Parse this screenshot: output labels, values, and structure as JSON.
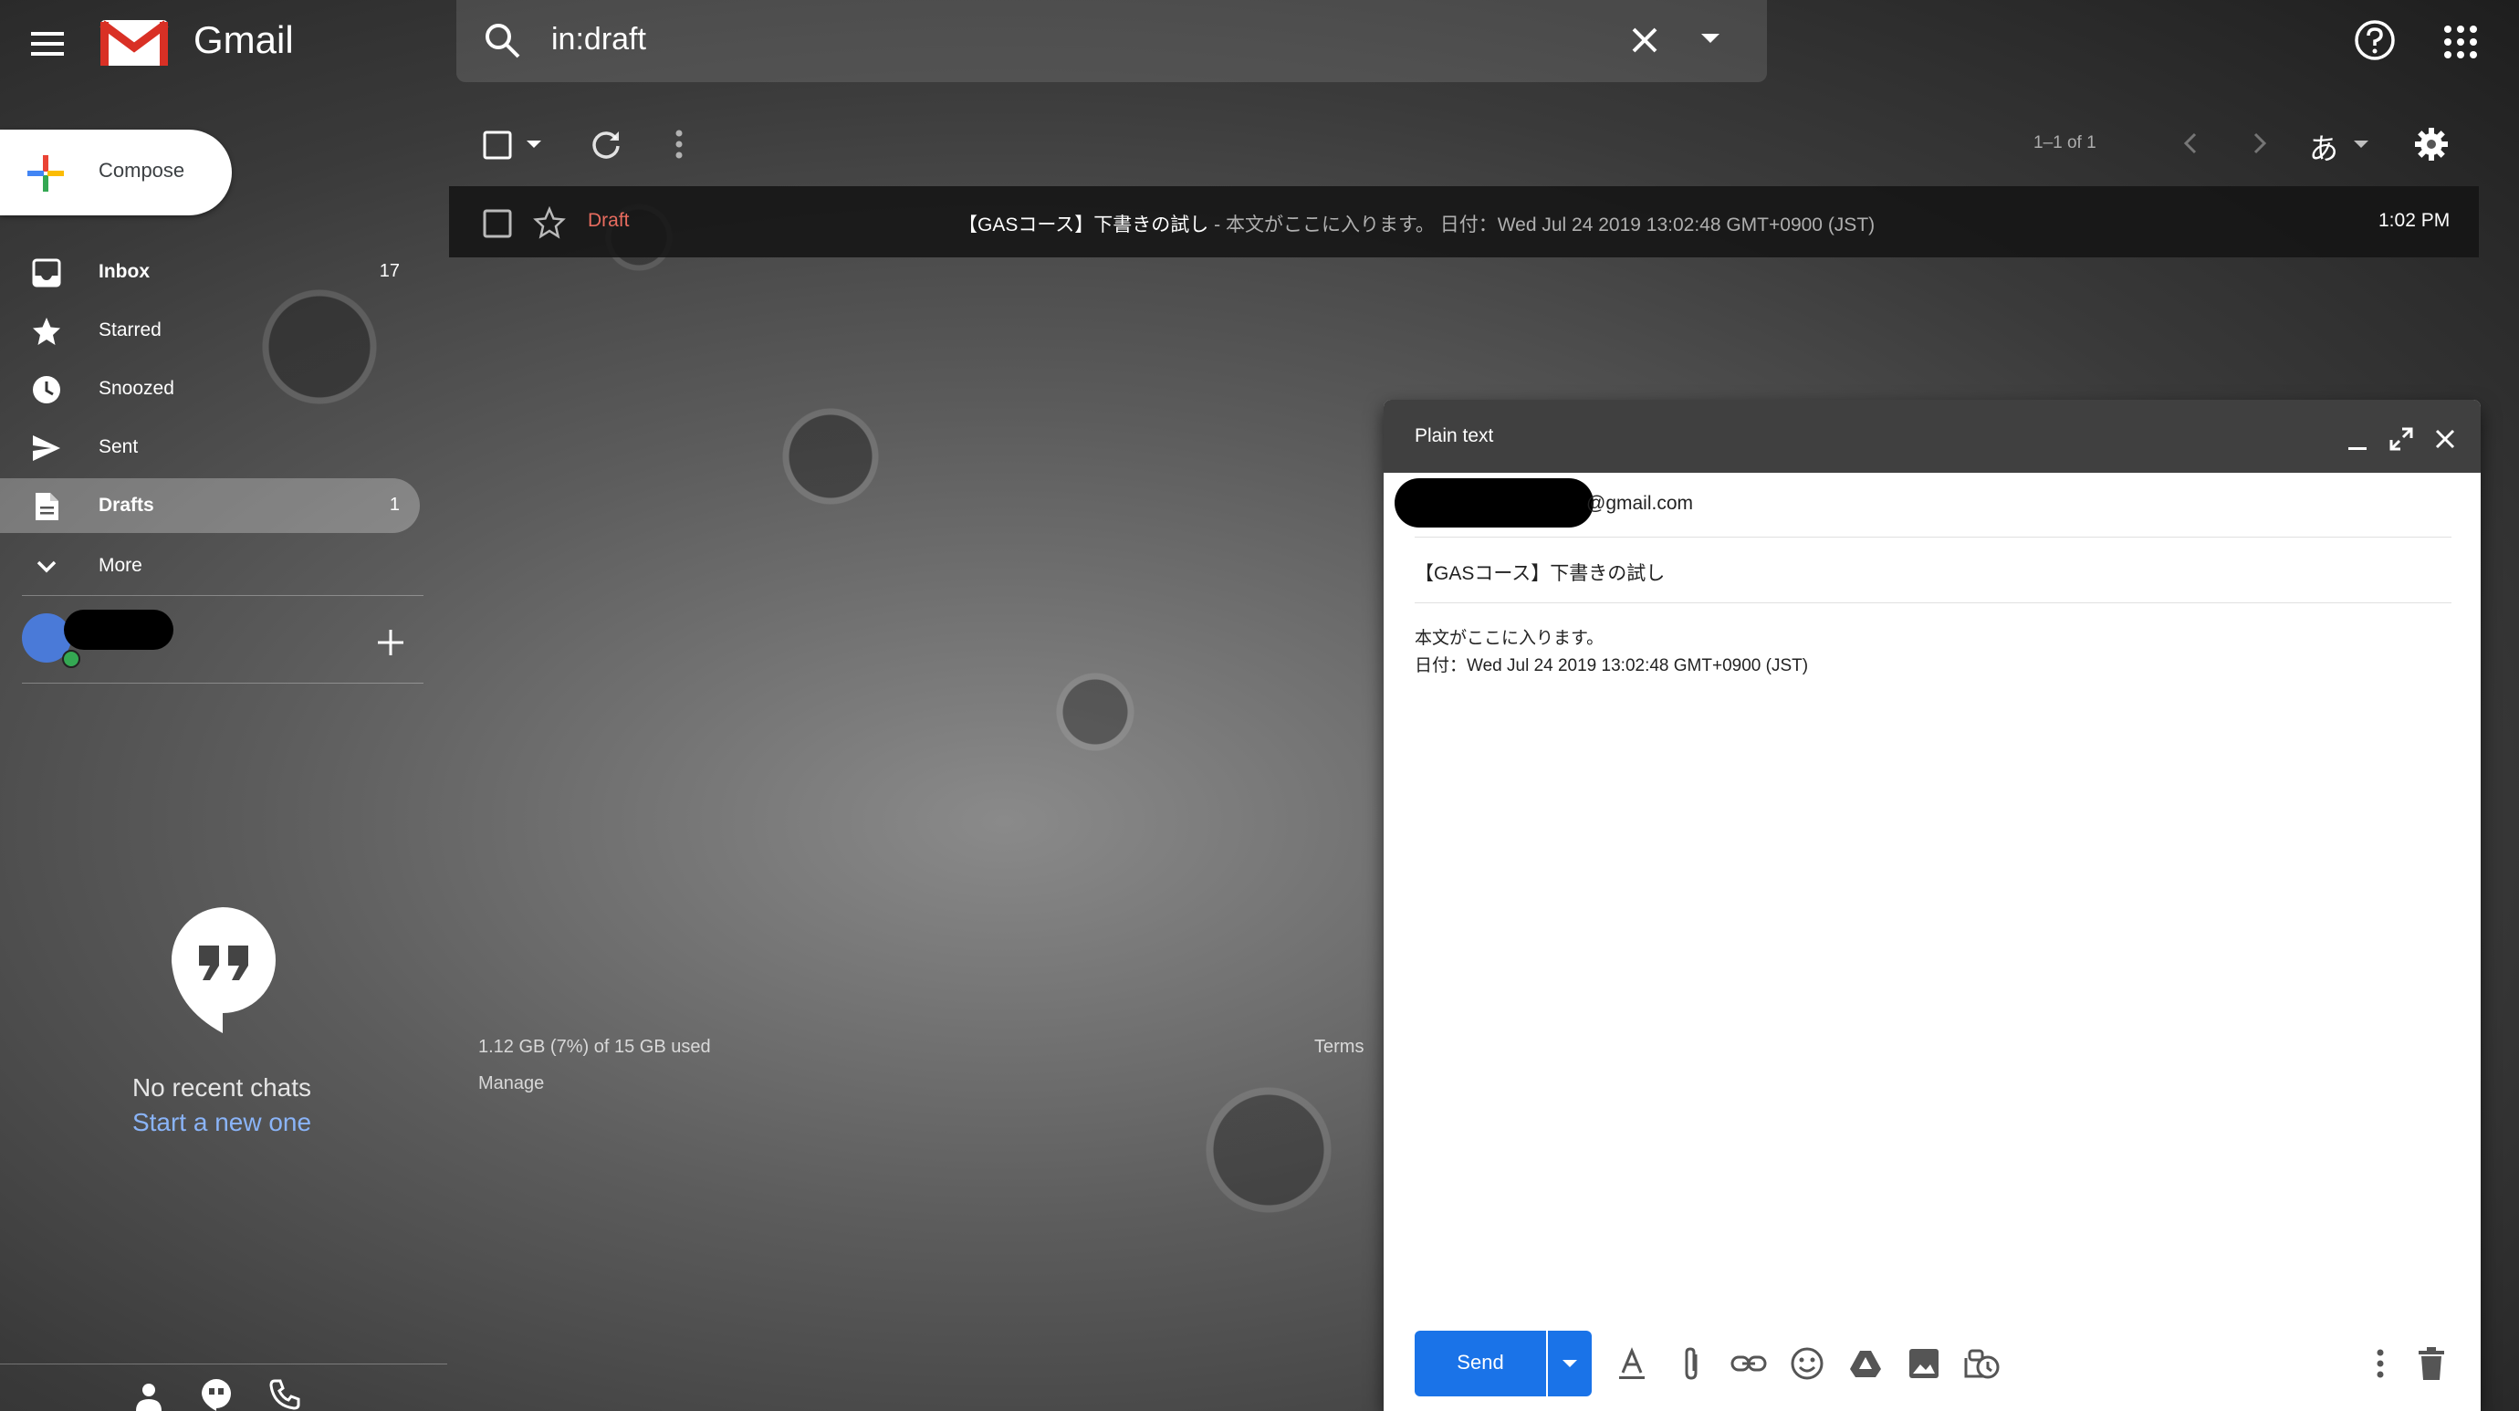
{
  "app": {
    "title": "Gmail"
  },
  "search": {
    "query": "in:draft"
  },
  "compose_button": {
    "label": "Compose"
  },
  "sidebar": {
    "items": [
      {
        "label": "Inbox",
        "count": "17"
      },
      {
        "label": "Starred",
        "count": ""
      },
      {
        "label": "Snoozed",
        "count": ""
      },
      {
        "label": "Sent",
        "count": ""
      },
      {
        "label": "Drafts",
        "count": "1"
      },
      {
        "label": "More",
        "count": ""
      }
    ]
  },
  "chat": {
    "empty_message": "No recent chats",
    "start_link": "Start a new one"
  },
  "toolbar": {
    "pager": "1–1 of 1",
    "input_tool": "あ"
  },
  "email_row": {
    "label": "Draft",
    "subject": "【GASコース】下書きの試し",
    "snippet": " - 本文がここに入ります。 日付：Wed Jul 24 2019 13:02:48 GMT+0900 (JST)",
    "time": "1:02 PM"
  },
  "footer": {
    "storage": "1.12 GB (7%) of 15 GB used",
    "manage": "Manage",
    "terms": "Terms"
  },
  "compose_window": {
    "title": "Plain text",
    "to": "@gmail.com",
    "subject": "【GASコース】下書きの試し",
    "body_line1": "本文がここに入ります。",
    "body_line2": "日付：Wed Jul 24 2019 13:02:48 GMT+0900 (JST)",
    "send_label": "Send"
  },
  "colors": {
    "accent": "#1a73e8",
    "draft_label": "#e86c5f",
    "compose_header": "#404040"
  }
}
